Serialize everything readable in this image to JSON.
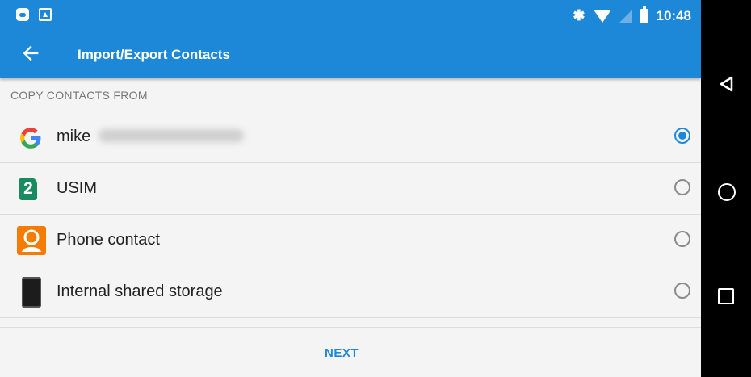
{
  "status_bar": {
    "time": "10:48",
    "bluetooth": "✱"
  },
  "app_bar": {
    "title": "Import/Export Contacts"
  },
  "section_header": "COPY CONTACTS FROM",
  "options": [
    {
      "label": "mike",
      "icon": "google-icon",
      "selected": true
    },
    {
      "label": "USIM",
      "icon": "sim-2-icon",
      "badge": "2",
      "selected": false
    },
    {
      "label": "Phone contact",
      "icon": "phone-contact-icon",
      "selected": false
    },
    {
      "label": "Internal shared storage",
      "icon": "device-storage-icon",
      "selected": false
    }
  ],
  "actions": {
    "next": "NEXT"
  },
  "colors": {
    "accent": "#1e88d8",
    "sim_green": "#1a8a62",
    "contact_orange": "#f57c00"
  }
}
